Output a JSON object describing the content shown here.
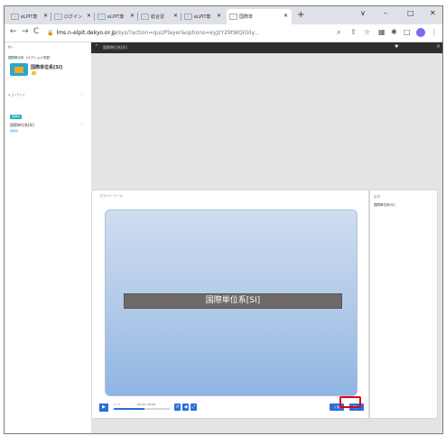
{
  "tabs": [
    {
      "label": "eLPIT専",
      "active": false
    },
    {
      "label": "ログイン",
      "active": false
    },
    {
      "label": "eLPIT専",
      "active": false
    },
    {
      "label": "総合習",
      "active": false
    },
    {
      "label": "eLPIT専",
      "active": false
    },
    {
      "label": "国際単",
      "active": true
    }
  ],
  "window": {
    "minimize": "–",
    "maximize": "□",
    "close": "✕",
    "dropdown": "∨",
    "new_tab": "+"
  },
  "toolbar": {
    "back": "←",
    "forward": "→",
    "reload": "C",
    "url_host": "lms.n-elpit.dekyo.or.jp",
    "url_rest": "/sys/?action=quizPlayer&options=eyJzY29tWQiOily...",
    "menu": "⋮"
  },
  "sidebar": {
    "top_label": "前へ",
    "course_path": "国際単位系（オプション学習）",
    "course_name": "国際単位系[SI]",
    "section_label": "≡ コンテンツ",
    "badge": "受講中",
    "item_name": "国際単位系[SI]",
    "item_status": "受講中"
  },
  "player": {
    "topbar_label": "国際単位系[SI]",
    "breadcrumb": "スライド  ツール",
    "slide_title": "国際単位系[SI]",
    "page_count": "1 / 7",
    "time": "00:00 / 00:00",
    "progress": 0.55,
    "prev_label": "く戻",
    "next_label": "次 >"
  },
  "toc": {
    "heading": "目次",
    "item": "国際単位系[SI]"
  },
  "colors": {
    "accent": "#2a6fd6",
    "highlight": "#e0001a",
    "course_icon": "#2aa6c8"
  }
}
